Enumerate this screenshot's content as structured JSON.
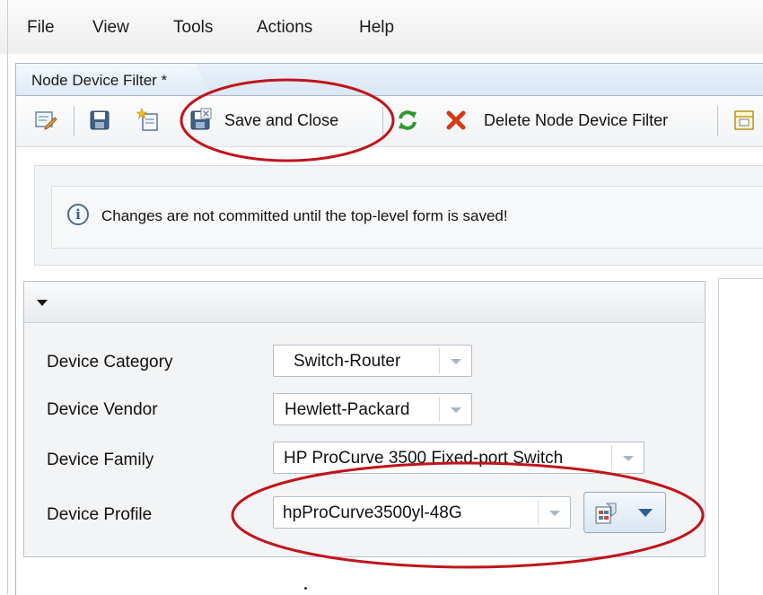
{
  "menu": {
    "items": [
      "File",
      "View",
      "Tools",
      "Actions",
      "Help"
    ]
  },
  "tab": {
    "label": "Node Device Filter *"
  },
  "toolbar": {
    "save_close_label": "Save and Close",
    "delete_label": "Delete Node Device Filter"
  },
  "info": {
    "glyph": "i",
    "message": "Changes are not committed until the top-level form is saved!"
  },
  "form": {
    "device_category": {
      "label": "Device Category",
      "value": "Switch-Router"
    },
    "device_vendor": {
      "label": "Device Vendor",
      "value": "Hewlett-Packard"
    },
    "device_family": {
      "label": "Device Family",
      "value": "HP ProCurve 3500 Fixed-port Switch"
    },
    "device_profile": {
      "label": "Device Profile",
      "value": "hpProCurve3500yl-48G"
    }
  },
  "colors": {
    "highlight_ellipse": "#c0141b",
    "accent_blue": "#2f5f93"
  },
  "icons": [
    "edit-icon",
    "save-icon",
    "new-icon",
    "save-close-icon",
    "refresh-icon",
    "delete-icon",
    "grid-icon",
    "info-icon",
    "collapse-arrow-icon",
    "profile-settings-icon"
  ]
}
